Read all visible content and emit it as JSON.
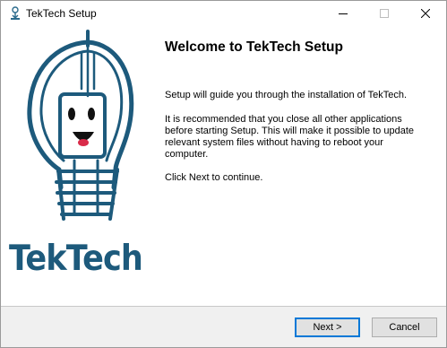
{
  "window": {
    "title": "TekTech Setup"
  },
  "logo": {
    "wordmark": "TekTech",
    "color": "#1d5a7c"
  },
  "content": {
    "heading": "Welcome to TekTech Setup",
    "paragraph1": "Setup will guide you through the installation of TekTech.",
    "paragraph2": "It is recommended that you close all other applications before starting Setup. This will make it possible to update relevant system files without having to reboot your computer.",
    "paragraph3": "Click Next to continue."
  },
  "buttons": {
    "next": "Next >",
    "cancel": "Cancel"
  },
  "colors": {
    "accent": "#0078d7",
    "footer_bg": "#f0f0f0",
    "tongue": "#d92b4a"
  }
}
